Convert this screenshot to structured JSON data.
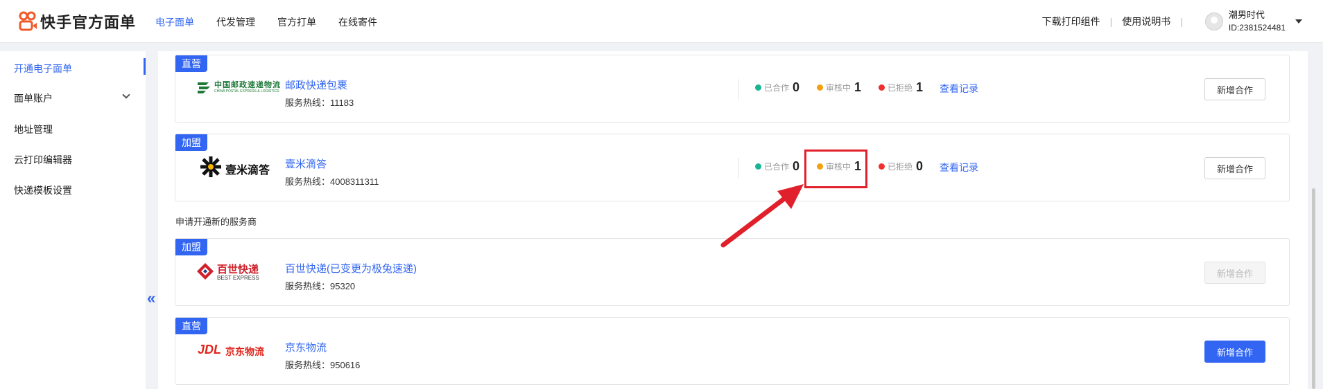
{
  "app": {
    "title": "快手官方面单"
  },
  "topnav": [
    "电子面单",
    "代发管理",
    "官方打单",
    "在线寄件"
  ],
  "header_right": {
    "download": "下载打印组件",
    "manual": "使用说明书",
    "sep": "|",
    "user_name": "潮男时代",
    "user_id": "ID:2381524481"
  },
  "sidebar": {
    "items": [
      "开通电子面单",
      "面单账户",
      "地址管理",
      "云打印编辑器",
      "快递模板设置"
    ],
    "collapse": "«"
  },
  "section_title": "申请开通新的服务商",
  "cards": [
    {
      "tag": "直营",
      "name": "邮政快递包裹",
      "hotline": "服务热线：11183",
      "logo_text": "中国邮政速递物流",
      "logo_sub": "CHINA POSTAL EXPRESS & LOGISTICS",
      "stats": {
        "cooperating_label": "已合作",
        "cooperating": "0",
        "reviewing_label": "审核中",
        "reviewing": "1",
        "rejected_label": "已拒绝",
        "rejected": "1"
      },
      "view": "查看记录",
      "button": "新增合作"
    },
    {
      "tag": "加盟",
      "name": "壹米滴答",
      "hotline": "服务热线：4008311311",
      "logo_text": "壹米滴答",
      "stats": {
        "cooperating_label": "已合作",
        "cooperating": "0",
        "reviewing_label": "审核中",
        "reviewing": "1",
        "rejected_label": "已拒绝",
        "rejected": "0"
      },
      "view": "查看记录",
      "button": "新增合作"
    },
    {
      "tag": "加盟",
      "name": "百世快递(已变更为极兔速递)",
      "hotline": "服务热线：95320",
      "logo_text": "百世快递",
      "logo_sub": "BEST EXPRESS",
      "button": "新增合作"
    },
    {
      "tag": "直营",
      "name": "京东物流",
      "hotline": "服务热线：950616",
      "logo_text": "京东物流",
      "logo_mark": "JDL",
      "button": "新增合作"
    }
  ],
  "colors": {
    "accent": "#3266f2",
    "green_dot": "#1ab394",
    "orange_dot": "#f5a00f",
    "red_dot": "#f03030",
    "highlight": "#e0202a"
  }
}
